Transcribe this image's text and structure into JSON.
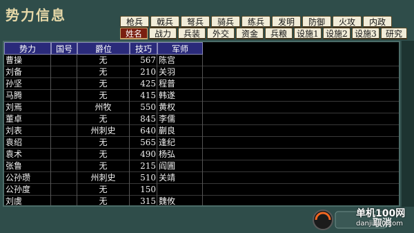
{
  "title": "势力信息",
  "tabs_row1": [
    "枪兵",
    "戟兵",
    "弩兵",
    "骑兵",
    "练兵",
    "发明",
    "防御",
    "火攻",
    "内政"
  ],
  "tabs_row2": [
    "姓名",
    "战力",
    "兵装",
    "外交",
    "资金",
    "兵粮",
    "设施1",
    "设施2",
    "设施3",
    "研究"
  ],
  "table": {
    "headers": [
      "势力",
      "国号",
      "爵位",
      "技巧",
      "军师"
    ],
    "rows": [
      {
        "name": "曹操",
        "flag": "",
        "rank": "无",
        "skill": "567",
        "advisor": "陈宫"
      },
      {
        "name": "刘备",
        "flag": "",
        "rank": "无",
        "skill": "210",
        "advisor": "关羽"
      },
      {
        "name": "孙坚",
        "flag": "",
        "rank": "无",
        "skill": "425",
        "advisor": "程普"
      },
      {
        "name": "马腾",
        "flag": "",
        "rank": "无",
        "skill": "415",
        "advisor": "韩遂"
      },
      {
        "name": "刘焉",
        "flag": "",
        "rank": "州牧",
        "skill": "550",
        "advisor": "黄权"
      },
      {
        "name": "董卓",
        "flag": "",
        "rank": "无",
        "skill": "845",
        "advisor": "李儒"
      },
      {
        "name": "刘表",
        "flag": "",
        "rank": "州刺史",
        "skill": "640",
        "advisor": "蒯良"
      },
      {
        "name": "袁绍",
        "flag": "",
        "rank": "无",
        "skill": "565",
        "advisor": "逢纪"
      },
      {
        "name": "袁术",
        "flag": "",
        "rank": "无",
        "skill": "490",
        "advisor": "杨弘"
      },
      {
        "name": "张鲁",
        "flag": "",
        "rank": "无",
        "skill": "215",
        "advisor": "阎圃"
      },
      {
        "name": "公孙瓒",
        "flag": "",
        "rank": "州刺史",
        "skill": "510",
        "advisor": "关靖"
      },
      {
        "name": "公孙度",
        "flag": "",
        "rank": "无",
        "skill": "150",
        "advisor": ""
      },
      {
        "name": "刘虞",
        "flag": "",
        "rank": "无",
        "skill": "315",
        "advisor": "魏攸"
      }
    ]
  },
  "cancel_label": "取消",
  "watermark": {
    "line1": "单机100网",
    "line2": "danji100.com"
  },
  "colors": {
    "background": "#2f4d4a",
    "header": "#2a2a7a",
    "active_tab": "#7a1f10"
  }
}
